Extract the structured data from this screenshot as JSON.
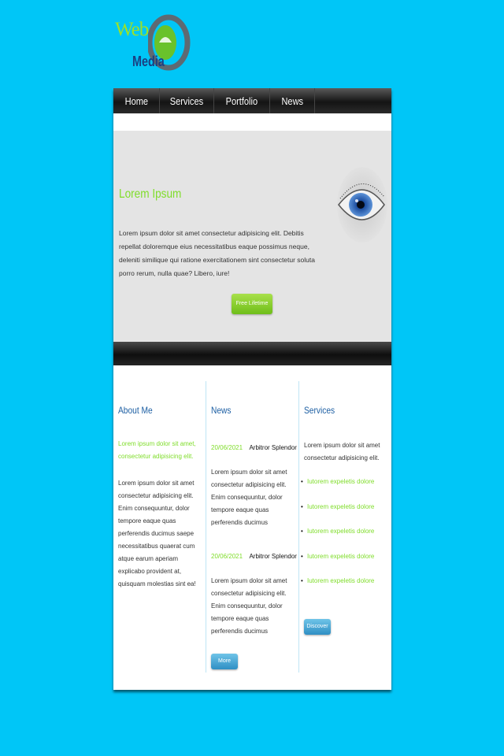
{
  "logo": {
    "line1": "Web",
    "line2": "Media"
  },
  "nav": {
    "items": [
      "Home",
      "Services",
      "Portfolio",
      "News"
    ]
  },
  "hero": {
    "title": "Lorem Ipsum",
    "text": "Lorem ipsum dolor sit amet consectetur adipisicing elit. Debitis repellat doloremque eius necessitatibus eaque possimus neque, deleniti similique qui ratione exercitationem sint consectetur soluta porro rerum, nulla quae? Libero, iure!",
    "button": "Free Lifetime"
  },
  "about": {
    "title": "About Me",
    "lead": "Lorem ipsum dolor sit amet, consectetur adipisicing elit.",
    "text": "Lorem ipsum dolor sit amet consectetur adipisicing elit. Enim consequuntur, dolor tempore eaque quas perferendis ducimus saepe necessitatibus quaerat cum atque earum aperiam explicabo provident at, quisquam molestias sint ea!"
  },
  "news": {
    "title": "News",
    "items": [
      {
        "date": "20/06/2021",
        "author": "Arbitror Splendor",
        "text": "Lorem ipsum dolor sit amet consectetur adipisicing elit. Enim consequuntur, dolor tempore eaque quas perferendis ducimus"
      },
      {
        "date": "20/06/2021",
        "author": "Arbitror Splendor",
        "text": "Lorem ipsum dolor sit amet consectetur adipisicing elit. Enim consequuntur, dolor tempore eaque quas perferendis ducimus"
      }
    ],
    "button": "More News"
  },
  "services": {
    "title": "Services",
    "intro": "Lorem ipsum dolor sit amet consectetur adipisicing elit.",
    "items": [
      "Iutorem expeletis dolore",
      "Iutorem expeletis dolore",
      "Iutorem expeletis dolore",
      "Iutorem expeletis dolore",
      "Iutorem expeletis dolore"
    ],
    "button": "Discover"
  },
  "colors": {
    "background": "#00c6f7",
    "accent_green": "#7fdd2a",
    "heading_blue": "#1d5fa3"
  }
}
